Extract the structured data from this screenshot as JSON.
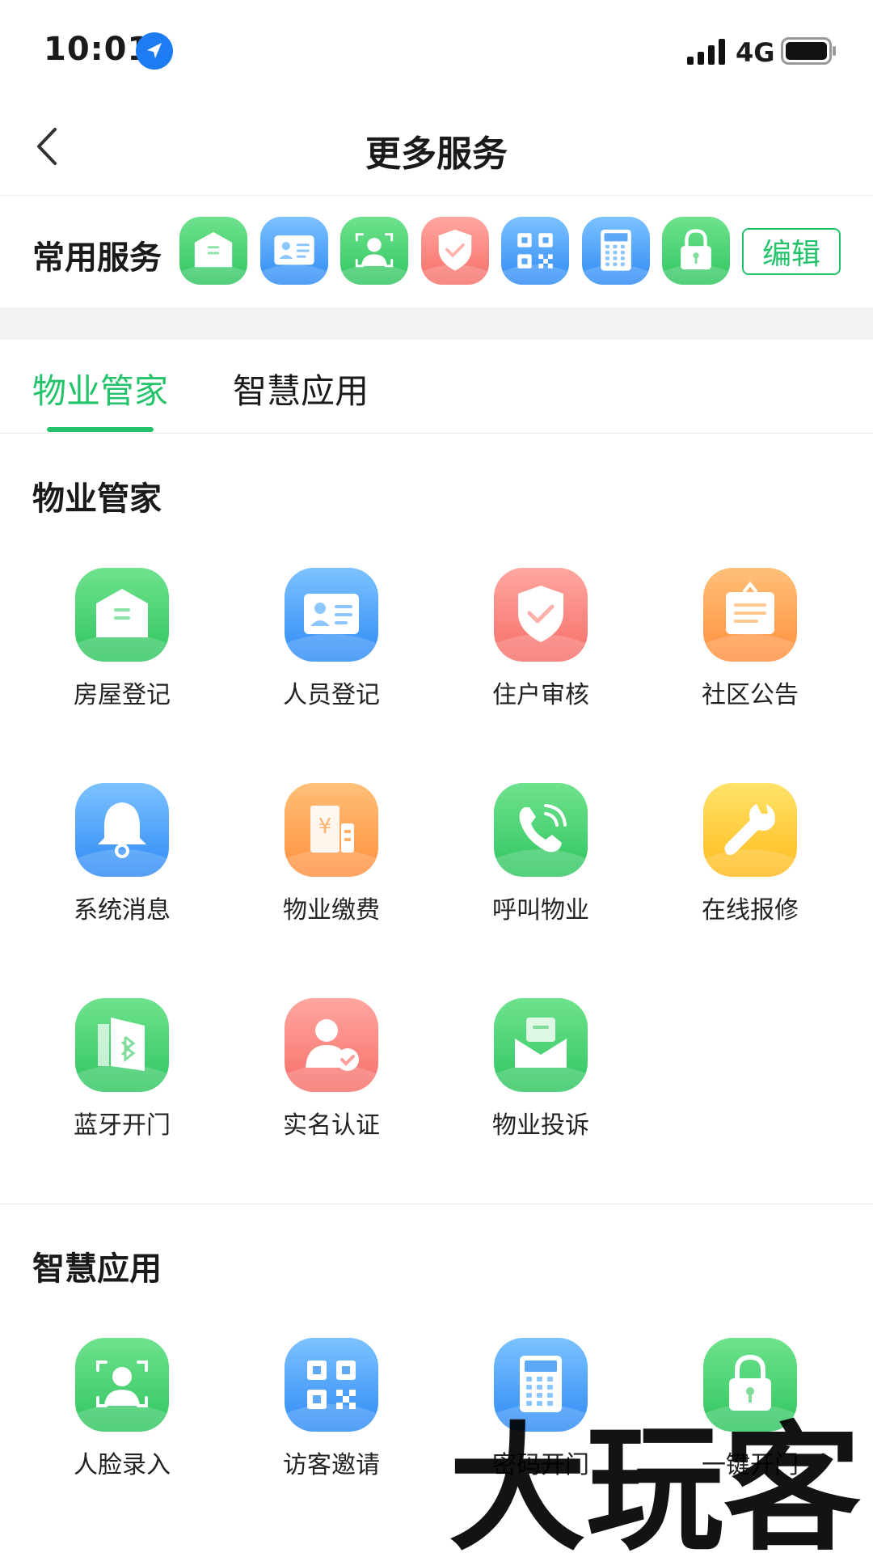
{
  "status_bar": {
    "time": "10:01",
    "network": "4G"
  },
  "nav": {
    "title": "更多服务"
  },
  "favorites": {
    "title": "常用服务",
    "edit_label": "编辑",
    "icons": [
      {
        "icon": "house-icon",
        "color": "green"
      },
      {
        "icon": "id-card-icon",
        "color": "blue"
      },
      {
        "icon": "face-scan-icon",
        "color": "green"
      },
      {
        "icon": "shield-check-icon",
        "color": "red"
      },
      {
        "icon": "qr-code-icon",
        "color": "blue"
      },
      {
        "icon": "calculator-icon",
        "color": "blue"
      },
      {
        "icon": "lock-icon",
        "color": "green"
      }
    ]
  },
  "tabs": [
    {
      "label": "物业管家",
      "active": true
    },
    {
      "label": "智慧应用",
      "active": false
    }
  ],
  "sections": [
    {
      "title": "物业管家",
      "items": [
        {
          "label": "房屋登记",
          "icon": "house-icon",
          "color": "green"
        },
        {
          "label": "人员登记",
          "icon": "id-card-icon",
          "color": "blue"
        },
        {
          "label": "住户审核",
          "icon": "shield-check-icon",
          "color": "red"
        },
        {
          "label": "社区公告",
          "icon": "notice-board-icon",
          "color": "orange"
        },
        {
          "label": "系统消息",
          "icon": "bell-icon",
          "color": "blue"
        },
        {
          "label": "物业缴费",
          "icon": "building-yuan-icon",
          "color": "orange"
        },
        {
          "label": "呼叫物业",
          "icon": "phone-icon",
          "color": "green"
        },
        {
          "label": "在线报修",
          "icon": "wrench-icon",
          "color": "yellow"
        },
        {
          "label": "蓝牙开门",
          "icon": "bluetooth-door-icon",
          "color": "green"
        },
        {
          "label": "实名认证",
          "icon": "user-verified-icon",
          "color": "red"
        },
        {
          "label": "物业投诉",
          "icon": "mail-icon",
          "color": "green"
        }
      ]
    },
    {
      "title": "智慧应用",
      "items": [
        {
          "label": "人脸录入",
          "icon": "face-scan-icon",
          "color": "green"
        },
        {
          "label": "访客邀请",
          "icon": "qr-code-icon",
          "color": "blue"
        },
        {
          "label": "密码开门",
          "icon": "calculator-icon",
          "color": "blue"
        },
        {
          "label": "一键开门",
          "icon": "lock-icon",
          "color": "green"
        }
      ]
    }
  ],
  "colors": {
    "accent": "#22c36a",
    "green": [
      "#6fe28d",
      "#2fc560"
    ],
    "blue": [
      "#7cc2ff",
      "#2e8af5"
    ],
    "red": [
      "#ffa7a0",
      "#f66e68"
    ],
    "orange": [
      "#ffc078",
      "#ff8f3e"
    ],
    "yellow": [
      "#ffe36a",
      "#ffba1c"
    ]
  },
  "watermark": {
    "text": "大玩客"
  }
}
